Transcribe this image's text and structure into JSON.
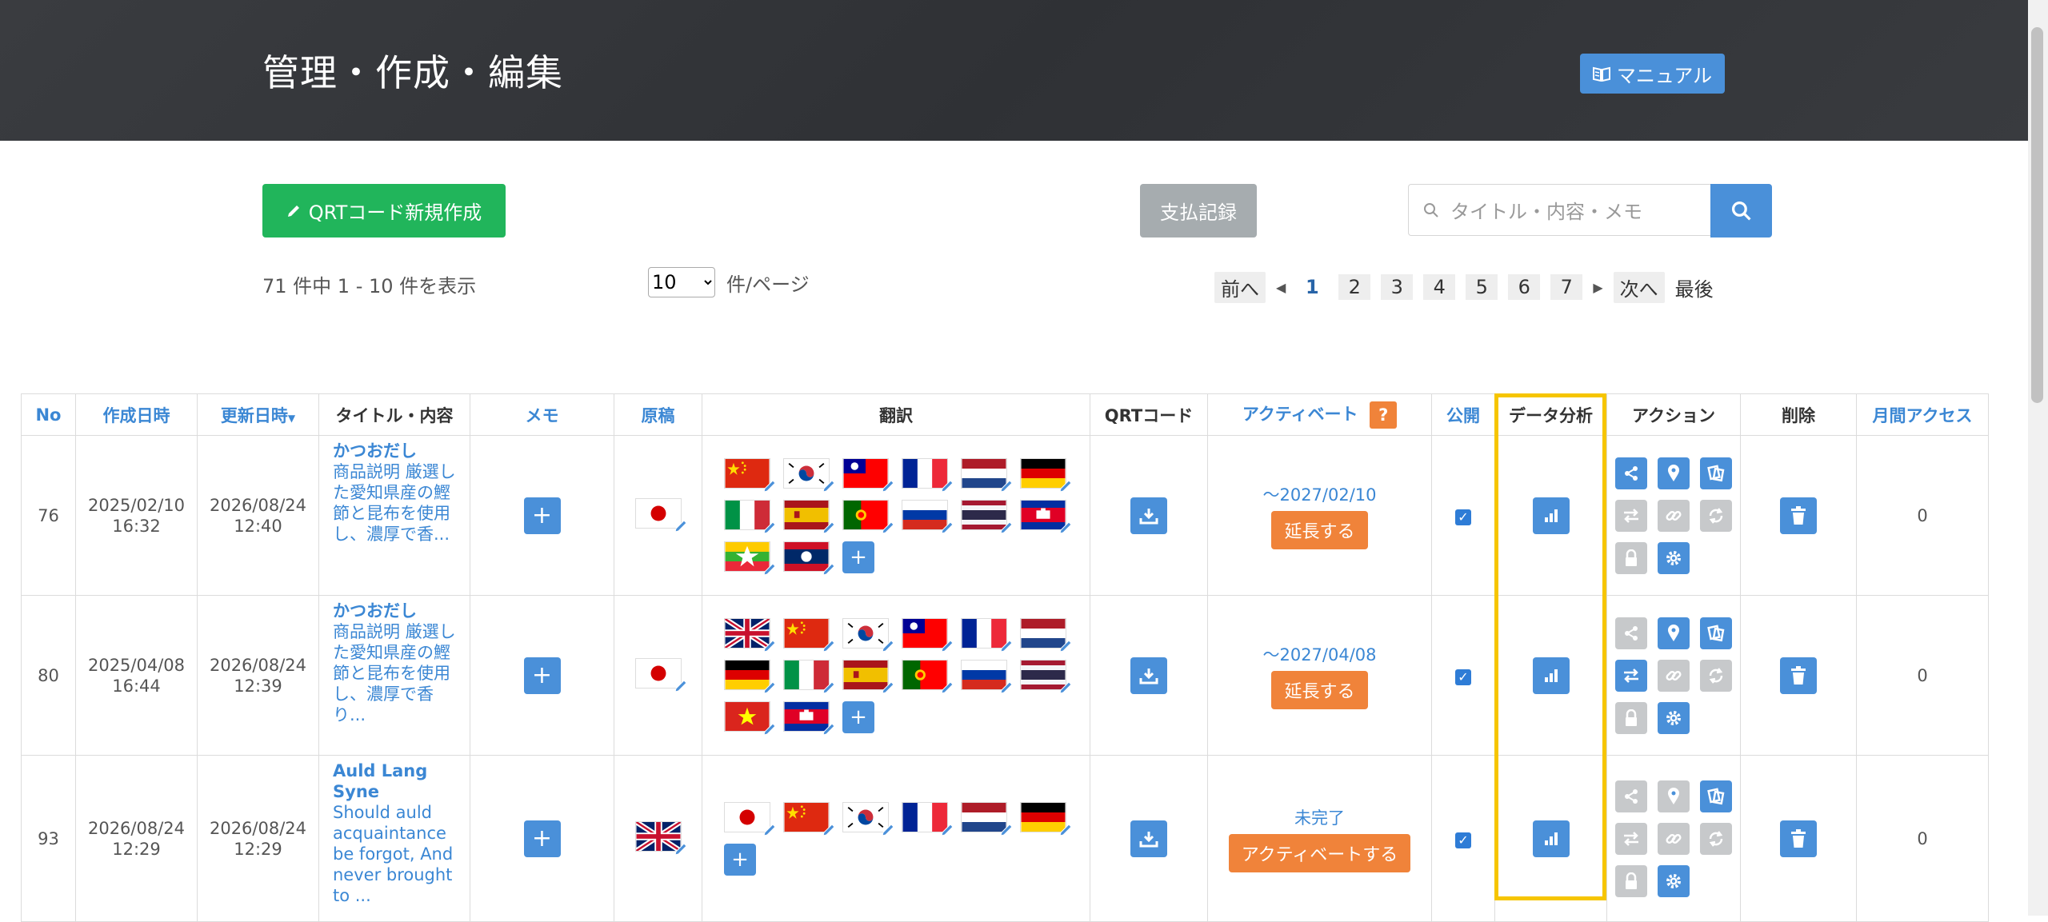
{
  "header": {
    "title": "管理・作成・編集",
    "manual_label": "マニュアル"
  },
  "toolbar": {
    "new_button": "QRTコード新規作成",
    "payment_button": "支払記録",
    "search_placeholder": "タイトル・内容・メモ"
  },
  "listing": {
    "count_text": "71 件中 1 - 10 件を表示",
    "per_page_value": "10",
    "per_page_label": "件/ページ"
  },
  "pagination": {
    "prev": "前へ",
    "next": "次へ",
    "last": "最後",
    "pages": [
      "1",
      "2",
      "3",
      "4",
      "5",
      "6",
      "7"
    ],
    "current": "1"
  },
  "table": {
    "columns": [
      "No",
      "作成日時",
      "更新日時",
      "タイトル・内容",
      "メモ",
      "原稿",
      "翻訳",
      "QRTコード",
      "アクティベート",
      "公開",
      "データ分析",
      "アクション",
      "削除",
      "月間アクセス"
    ],
    "help_mark": "?",
    "rows": [
      {
        "no": "76",
        "created_date": "2025/02/10",
        "created_time": "16:32",
        "updated_date": "2026/08/24",
        "updated_time": "12:40",
        "title": "かつおだし",
        "content": "商品説明 厳選した愛知県産の鰹節と昆布を使用し、濃厚で香...",
        "original_flag": "jp",
        "translations": [
          "cn",
          "kr",
          "tw",
          "fr",
          "nl",
          "de",
          "it",
          "es",
          "pt",
          "ru",
          "th",
          "kh",
          "mm",
          "la"
        ],
        "activation_text": "～2027/02/10",
        "activation_button": "延長する",
        "public": true,
        "access": "0"
      },
      {
        "no": "80",
        "created_date": "2025/04/08",
        "created_time": "16:44",
        "updated_date": "2026/08/24",
        "updated_time": "12:39",
        "title": "かつおだし",
        "content": "商品説明 厳選した愛知県産の鰹節と昆布を使用し、濃厚で香り...",
        "original_flag": "jp",
        "translations": [
          "gb",
          "cn",
          "kr",
          "tw",
          "fr",
          "nl",
          "de",
          "it",
          "es",
          "pt",
          "ru",
          "th",
          "vn",
          "kh"
        ],
        "activation_text": "～2027/04/08",
        "activation_button": "延長する",
        "public": true,
        "access": "0"
      },
      {
        "no": "93",
        "created_date": "2026/08/24",
        "created_time": "12:29",
        "updated_date": "2026/08/24",
        "updated_time": "12:29",
        "title": "Auld Lang Syne",
        "content": "Should auld acquaintance be forgot, And never brought to ...",
        "original_flag": "gb",
        "translations": [
          "jp",
          "cn",
          "kr",
          "fr",
          "nl",
          "de"
        ],
        "activation_text": "未完了",
        "activation_button": "アクティベートする",
        "public": true,
        "access": "0"
      }
    ]
  },
  "colors": {
    "blue": "#4a90d9",
    "green": "#21b55b",
    "orange": "#f0833a",
    "highlight": "#f6c500",
    "link": "#3b87d4"
  }
}
